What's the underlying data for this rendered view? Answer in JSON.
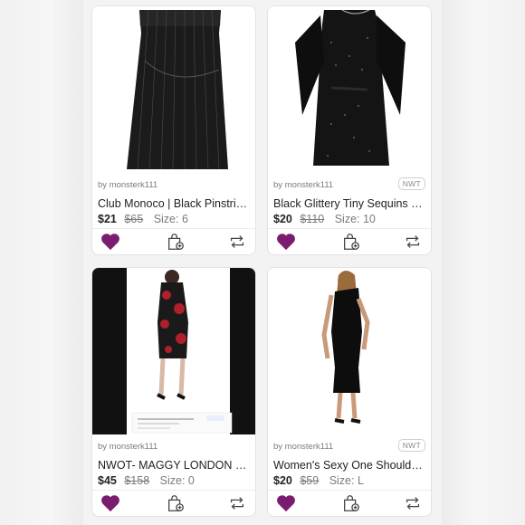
{
  "listings": [
    {
      "seller": "by monsterk111",
      "badge": "",
      "title": "Club Monoco | Black Pinstripe Skirt",
      "price": "$21",
      "original_price": "$65",
      "size": "Size: 6"
    },
    {
      "seller": "by monsterk111",
      "badge": "NWT",
      "title": "Black Glittery Tiny Sequins Flutter Dress",
      "price": "$20",
      "original_price": "$110",
      "size": "Size: 10"
    },
    {
      "seller": "by monsterk111",
      "badge": "",
      "title": "NWOT- MAGGY LONDON Floral Lace Dress",
      "price": "$45",
      "original_price": "$158",
      "size": "Size: 0"
    },
    {
      "seller": "by monsterk111",
      "badge": "NWT",
      "title": "Women's Sexy One Shoulder Midi Dress",
      "price": "$20",
      "original_price": "$59",
      "size": "Size: L"
    }
  ],
  "icons": {
    "like": "heart-icon",
    "bag": "shopping-bag-plus-icon",
    "share": "share-repost-icon"
  },
  "colors": {
    "heart": "#7b1d6e",
    "text": "#222222",
    "muted": "#7b7b7b"
  }
}
